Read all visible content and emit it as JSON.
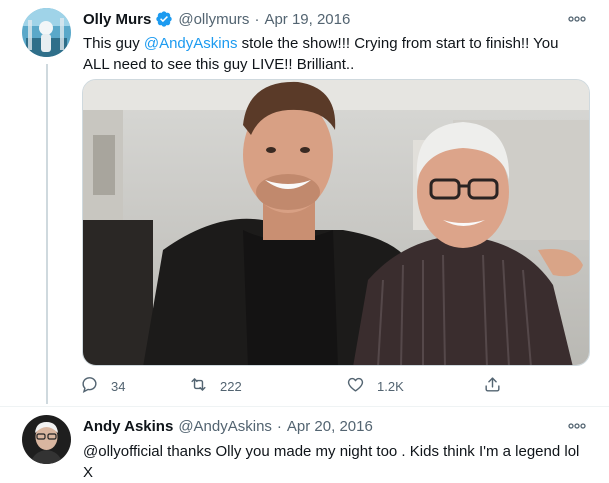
{
  "tweet": {
    "author_name": "Olly Murs",
    "handle": "@ollymurs",
    "separator": "·",
    "date": "Apr 19, 2016",
    "text_before": "This guy ",
    "mention": "@AndyAskins",
    "text_after": " stole the show!!! Crying from start to finish!! You ALL need to see this guy LIVE!! Brilliant..",
    "verified": true,
    "stats": {
      "replies": "34",
      "retweets": "222",
      "likes": "1.2K"
    }
  },
  "reply": {
    "author_name": "Andy Askins",
    "handle": "@AndyAskins",
    "separator": "·",
    "date": "Apr 20, 2016",
    "text": "@ollyofficial thanks Olly you made my night too . Kids think I'm a legend lol X"
  },
  "icons": {
    "reply": "reply-icon",
    "retweet": "retweet-icon",
    "like": "heart-icon",
    "share": "share-icon",
    "more": "more-icon",
    "verified": "verified-badge-icon"
  },
  "colors": {
    "accent": "#1d9bf0",
    "secondary_text": "#536471",
    "primary_text": "#0f1419"
  }
}
